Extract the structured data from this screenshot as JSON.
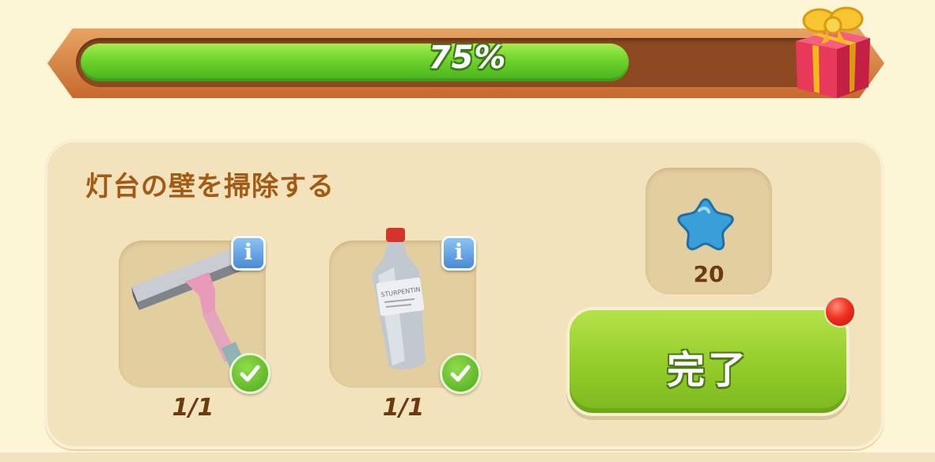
{
  "progress": {
    "percent": 75,
    "label": "75%",
    "reward_icon": "gift-box-icon"
  },
  "task": {
    "title": "灯台の壁を掃除する",
    "items": [
      {
        "icon": "squeegee-icon",
        "info_icon": "info-icon",
        "status_icon": "checkmark-icon",
        "count": "1/1"
      },
      {
        "icon": "turpentine-bottle-icon",
        "info_icon": "info-icon",
        "status_icon": "checkmark-icon",
        "count": "1/1"
      }
    ],
    "reward": {
      "icon": "blue-star-icon",
      "amount": "20"
    },
    "complete_button": {
      "label": "完了",
      "notification_icon": "red-dot-icon"
    }
  },
  "colors": {
    "progress_fill": "#6dd22c",
    "title": "#a35a14",
    "button": "#93cc2a",
    "info": "#4a8ad6",
    "star": "#3a9fd8"
  }
}
